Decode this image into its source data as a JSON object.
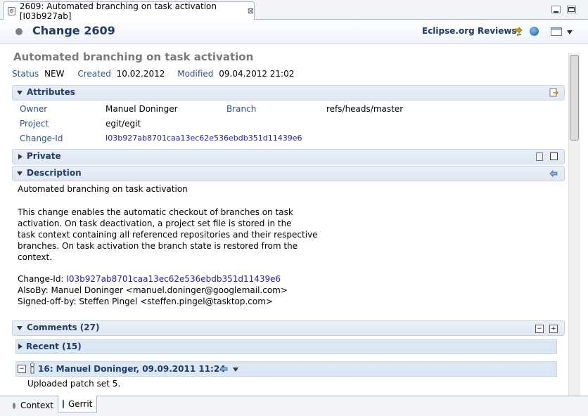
{
  "tab": {
    "title": "2609: Automated branching on task activation [I03b927ab]",
    "close": "⊠"
  },
  "header": {
    "title": "Change 2609",
    "repository": "Eclipse.org Reviews"
  },
  "summary": "Automated branching on task activation",
  "status": {
    "status_label": "Status",
    "status_value": "NEW",
    "created_label": "Created",
    "created_value": "10.02.2012",
    "modified_label": "Modified",
    "modified_value": "09.04.2012 21:02"
  },
  "attributes": {
    "title": "Attributes",
    "owner_label": "Owner",
    "owner_value": "Manuel Doninger",
    "branch_label": "Branch",
    "branch_value": "refs/heads/master",
    "project_label": "Project",
    "project_value": "egit/egit",
    "changeid_label": "Change-Id",
    "changeid_value": "I03b927ab8701caa13ec62e536ebdb351d11439e6"
  },
  "private": {
    "title": "Private"
  },
  "description": {
    "title": "Description",
    "line1": "Automated branching on task activation",
    "para": "This change enables the automatic checkout of branches on task\nactivation. On task deactivation, a project set file is stored in the\ntask context containing all referenced repositories and their respective\nbranches. On task activation the branch state is restored from the\ncontext.",
    "changeid_prefix": "Change-Id: ",
    "changeid_link": "I03b927ab8701caa13ec62e536ebdb351d11439e6",
    "alsoby": "AlsoBy: Manuel Doninger <manuel.doninger@googlemail.com>",
    "signedoff": "Signed-off-by: Steffen Pingel <steffen.pingel@tasktop.com>"
  },
  "comments": {
    "title": "Comments (27)",
    "recent": "Recent (15)",
    "entry_header": "16: Manuel Doninger, 09.09.2011 11:24",
    "entry_text": "Uploaded patch set 5."
  },
  "bottom_tabs": {
    "context": "Context",
    "gerrit": "Gerrit"
  }
}
